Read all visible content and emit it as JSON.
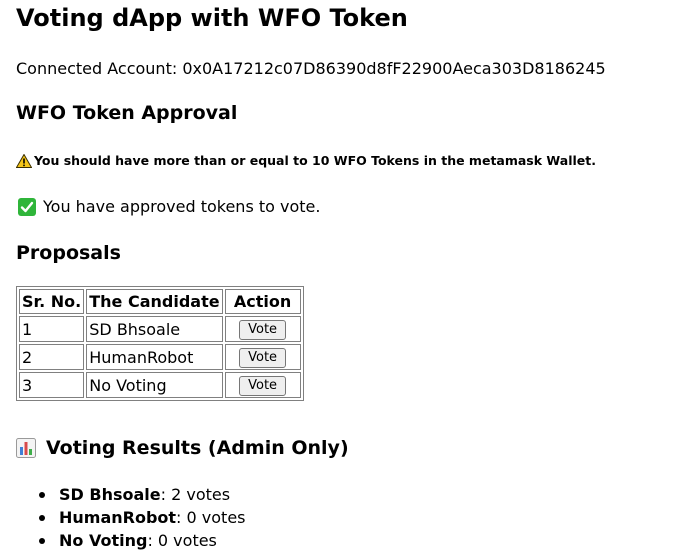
{
  "page": {
    "title": "Voting dApp with WFO Token",
    "account_label": "Connected Account: ",
    "account_address": "0x0A17212c07D86390d8fF22900Aeca303D8186245"
  },
  "approval": {
    "heading": "WFO Token Approval",
    "warning_icon": "warning-icon",
    "warning_text": "You should have more than or equal to 10 WFO Tokens in the metamask Wallet.",
    "status_icon": "check-icon",
    "status_text": "You have approved tokens to vote."
  },
  "proposals": {
    "heading": "Proposals",
    "columns": [
      "Sr. No.",
      "The Candidate",
      "Action"
    ],
    "rows": [
      {
        "sr": "1",
        "candidate": "SD Bhsoale",
        "action": "Vote"
      },
      {
        "sr": "2",
        "candidate": "HumanRobot",
        "action": "Vote"
      },
      {
        "sr": "3",
        "candidate": "No Voting",
        "action": "Vote"
      }
    ]
  },
  "results": {
    "icon": "bar-chart-icon",
    "heading": "Voting Results (Admin Only)",
    "items": [
      {
        "name": "SD Bhsoale",
        "votes": ": 2 votes"
      },
      {
        "name": "HumanRobot",
        "votes": ": 0 votes"
      },
      {
        "name": "No Voting",
        "votes": ": 0 votes"
      }
    ]
  },
  "colors": {
    "check_green": "#2fb53a",
    "warning_yellow": "#f5c518",
    "border_gray": "#808080"
  }
}
